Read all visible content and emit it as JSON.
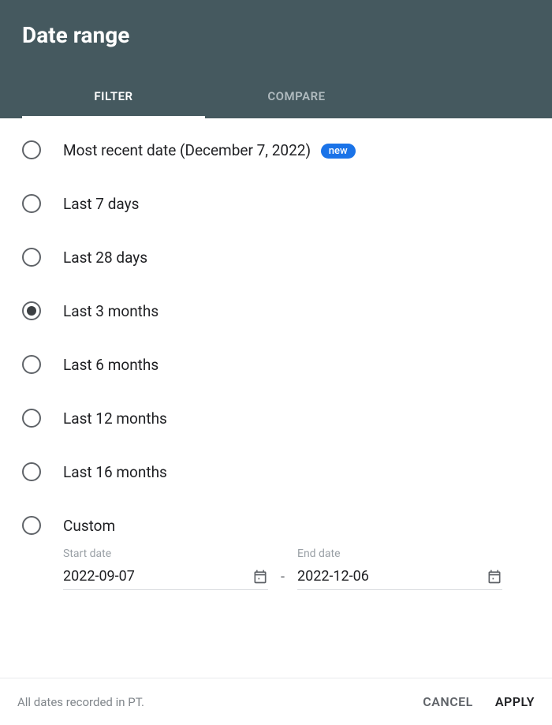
{
  "header": {
    "title": "Date range"
  },
  "tabs": [
    {
      "label": "FILTER",
      "active": true
    },
    {
      "label": "COMPARE",
      "active": false
    }
  ],
  "options": [
    {
      "label": "Most recent date (December 7, 2022)",
      "badge": "new",
      "selected": false
    },
    {
      "label": "Last 7 days",
      "selected": false
    },
    {
      "label": "Last 28 days",
      "selected": false
    },
    {
      "label": "Last 3 months",
      "selected": true
    },
    {
      "label": "Last 6 months",
      "selected": false
    },
    {
      "label": "Last 12 months",
      "selected": false
    },
    {
      "label": "Last 16 months",
      "selected": false
    },
    {
      "label": "Custom",
      "selected": false
    }
  ],
  "dateFields": {
    "start": {
      "label": "Start date",
      "value": "2022-09-07"
    },
    "end": {
      "label": "End date",
      "value": "2022-12-06"
    },
    "separator": "-"
  },
  "footer": {
    "note": "All dates recorded in PT.",
    "cancel": "CANCEL",
    "apply": "APPLY"
  }
}
